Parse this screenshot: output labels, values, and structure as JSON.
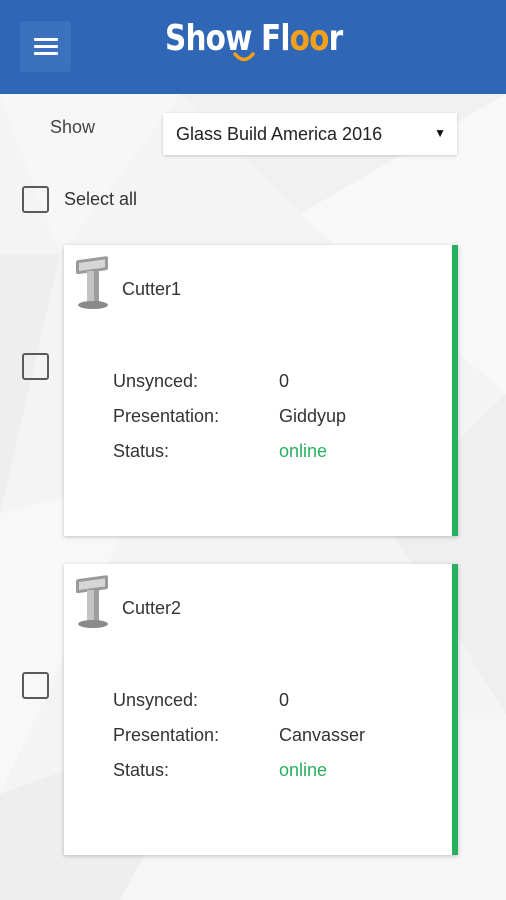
{
  "header": {
    "menu_icon": "hamburger-menu-icon",
    "logo_part1": "Show Fl",
    "logo_part2": "oo",
    "logo_part3": "r",
    "brand_color": "#2f66b5",
    "accent_color": "#f5a01a"
  },
  "filter": {
    "show_label": "Show",
    "show_selected": "Glass Build America 2016",
    "dropdown_icon": "triangle-down-icon"
  },
  "select_all": {
    "label": "Select all",
    "checked": false
  },
  "devices": [
    {
      "name": "Cutter1",
      "icon": "kiosk-icon",
      "checked": false,
      "unsynced_label": "Unsynced:",
      "unsynced_value": "0",
      "presentation_label": "Presentation:",
      "presentation_value": "Giddyup",
      "status_label": "Status:",
      "status_value": "online",
      "status_color": "#27b05d"
    },
    {
      "name": "Cutter2",
      "icon": "kiosk-icon",
      "checked": false,
      "unsynced_label": "Unsynced:",
      "unsynced_value": "0",
      "presentation_label": "Presentation:",
      "presentation_value": "Canvasser",
      "status_label": "Status:",
      "status_value": "online",
      "status_color": "#27b05d"
    }
  ]
}
